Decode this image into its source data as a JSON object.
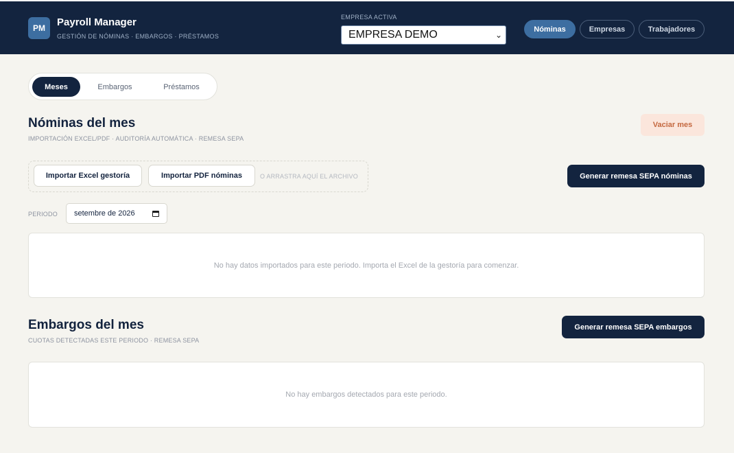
{
  "header": {
    "logo": "PM",
    "title": "Payroll Manager",
    "subtitle": "GESTIÓN DE NÓMINAS · EMBARGOS · PRÉSTAMOS",
    "empresa_label": "EMPRESA ACTIVA",
    "empresa_value": "EMPRESA DEMO",
    "nav": [
      {
        "label": "Nóminas",
        "active": true
      },
      {
        "label": "Empresas",
        "active": false
      },
      {
        "label": "Trabajadores",
        "active": false
      }
    ]
  },
  "tabs": [
    {
      "label": "Meses",
      "active": true
    },
    {
      "label": "Embargos",
      "active": false
    },
    {
      "label": "Préstamos",
      "active": false
    }
  ],
  "nominas": {
    "title": "Nóminas del mes",
    "subtitle": "IMPORTACIÓN EXCEL/PDF · AUDITORÍA AUTOMÁTICA · REMESA SEPA",
    "vaciar_label": "Vaciar mes",
    "import_excel_label": "Importar Excel gestoría",
    "import_pdf_label": "Importar PDF nóminas",
    "drop_hint": "O ARRASTRA AQUÍ EL ARCHIVO",
    "sepa_label": "Generar remesa SEPA nóminas",
    "periodo_label": "PERIODO",
    "periodo_value": "setembre de 2026",
    "empty_message": "No hay datos importados para este periodo. Importa el Excel de la gestoría para comenzar."
  },
  "embargos": {
    "title": "Embargos del mes",
    "subtitle": "CUOTAS DETECTADAS ESTE PERIODO · REMESA SEPA",
    "sepa_label": "Generar remesa SEPA embargos",
    "empty_message": "No hay embargos detectados para este periodo."
  },
  "colors": {
    "navy": "#13243f",
    "accent": "#3d6ea1",
    "background": "#f5f4ef",
    "warning_bg": "#fbe6dc",
    "warning_text": "#c4683f"
  }
}
